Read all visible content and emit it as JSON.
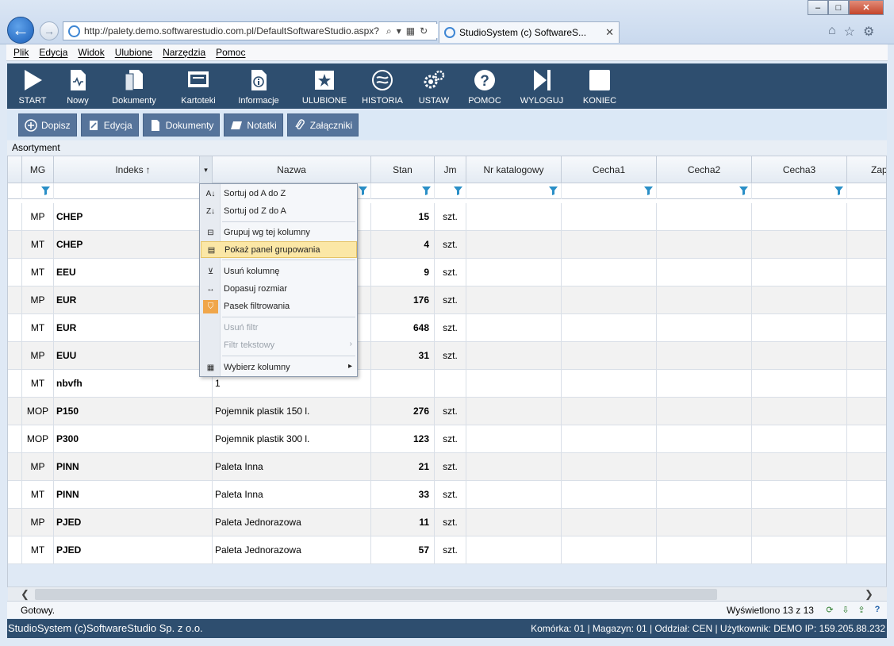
{
  "browser": {
    "address": "http://palety.demo.softwarestudio.com.pl/DefaultSoftwareStudio.aspx?",
    "tab_title": "StudioSystem (c) SoftwareS..."
  },
  "menubar": [
    "Plik",
    "Edycja",
    "Widok",
    "Ulubione",
    "Narzędzia",
    "Pomoc"
  ],
  "toolbar": [
    {
      "label": "START",
      "icon": "play-icon"
    },
    {
      "label": "Nowy",
      "icon": "new-document-icon"
    },
    {
      "label": "Dokumenty",
      "icon": "documents-icon"
    },
    {
      "label": "Kartoteki",
      "icon": "card-index-icon"
    },
    {
      "label": "Informacje",
      "icon": "info-icon"
    },
    {
      "label": "ULUBIONE",
      "icon": "favorites-icon"
    },
    {
      "label": "HISTORIA",
      "icon": "history-icon"
    },
    {
      "label": "USTAW",
      "icon": "settings-gears-icon"
    },
    {
      "label": "POMOC",
      "icon": "help-icon"
    },
    {
      "label": "WYLOGUJ",
      "icon": "logout-icon"
    },
    {
      "label": "KONIEC",
      "icon": "end-icon"
    }
  ],
  "actions": [
    {
      "label": "Dopisz",
      "icon": "add-circle-icon"
    },
    {
      "label": "Edycja",
      "icon": "edit-icon"
    },
    {
      "label": "Dokumenty",
      "icon": "document-icon"
    },
    {
      "label": "Notatki",
      "icon": "notes-icon"
    },
    {
      "label": "Załączniki",
      "icon": "paperclip-icon"
    }
  ],
  "section_title": "Asortyment",
  "columns": [
    "MG",
    "Indeks",
    "Nazwa",
    "Stan",
    "Jm",
    "Nr katalogowy",
    "Cecha1",
    "Cecha2",
    "Cecha3",
    "Zapas"
  ],
  "sort_indicator": "↑",
  "rows": [
    {
      "mg": "MP",
      "indeks": "CHEP",
      "nazwa": "",
      "stan": "15",
      "jm": "szt."
    },
    {
      "mg": "MT",
      "indeks": "CHEP",
      "nazwa": "",
      "stan": "4",
      "jm": "szt."
    },
    {
      "mg": "MT",
      "indeks": "EEU",
      "nazwa": "",
      "stan": "9",
      "jm": "szt."
    },
    {
      "mg": "MP",
      "indeks": "EUR",
      "nazwa": "",
      "stan": "176",
      "jm": "szt."
    },
    {
      "mg": "MT",
      "indeks": "EUR",
      "nazwa": "",
      "stan": "648",
      "jm": "szt."
    },
    {
      "mg": "MP",
      "indeks": "EUU",
      "nazwa": "",
      "stan": "31",
      "jm": "szt."
    },
    {
      "mg": "MT",
      "indeks": "nbvfh",
      "nazwa": "1",
      "stan": "",
      "jm": ""
    },
    {
      "mg": "MOP",
      "indeks": "P150",
      "nazwa": "Pojemnik plastik 150 l.",
      "stan": "276",
      "jm": "szt."
    },
    {
      "mg": "MOP",
      "indeks": "P300",
      "nazwa": "Pojemnik plastik 300 l.",
      "stan": "123",
      "jm": "szt."
    },
    {
      "mg": "MP",
      "indeks": "PINN",
      "nazwa": "Paleta Inna",
      "stan": "21",
      "jm": "szt."
    },
    {
      "mg": "MT",
      "indeks": "PINN",
      "nazwa": "Paleta Inna",
      "stan": "33",
      "jm": "szt."
    },
    {
      "mg": "MP",
      "indeks": "PJED",
      "nazwa": "Paleta Jednorazowa",
      "stan": "11",
      "jm": "szt."
    },
    {
      "mg": "MT",
      "indeks": "PJED",
      "nazwa": "Paleta Jednorazowa",
      "stan": "57",
      "jm": "szt."
    }
  ],
  "context_menu": {
    "sort_asc": "Sortuj od A do Z",
    "sort_desc": "Sortuj od Z do A",
    "group_by": "Grupuj wg tej kolumny",
    "show_group_panel": "Pokaż panel grupowania",
    "remove_column": "Usuń kolumnę",
    "best_fit": "Dopasuj rozmiar",
    "filter_bar": "Pasek filtrowania",
    "remove_filter": "Usuń filtr",
    "text_filter": "Filtr tekstowy",
    "choose_columns": "Wybierz kolumny"
  },
  "status": {
    "ready": "Gotowy.",
    "shown": "Wyświetlono 13 z 13"
  },
  "footer": {
    "left": "StudioSystem (c)SoftwareStudio Sp. z o.o.",
    "right": "Komórka: 01 | Magazyn: 01 | Oddział: CEN | Użytkownik: DEMO IP: 159.205.88.232"
  },
  "colors": {
    "toolbar_bg": "#2e4e6f",
    "action_button": "#56749b",
    "highlight": "#fbe7a6"
  }
}
